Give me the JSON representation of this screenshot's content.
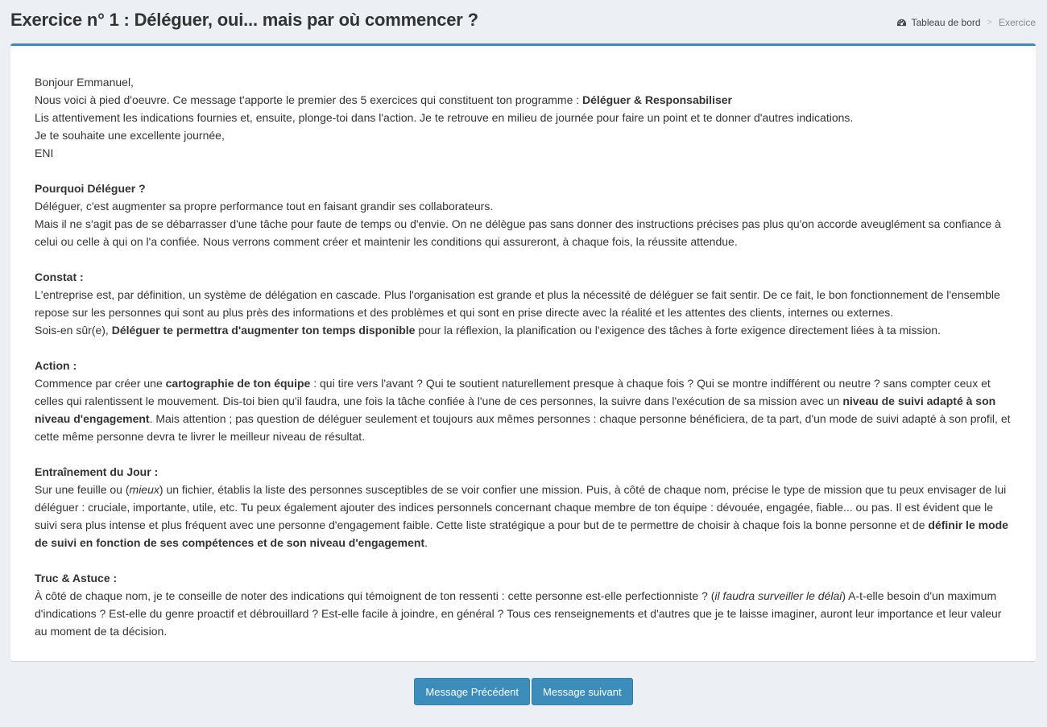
{
  "header": {
    "title": "Exercice n° 1 : Déléguer, oui... mais par où commencer ?",
    "breadcrumb": {
      "home": "Tableau de bord",
      "current": "Exercice"
    }
  },
  "message": {
    "intro": {
      "greeting": "Bonjour Emmanuel,",
      "line2_text": "Nous voici à pied d'oeuvre. Ce message t'apporte le premier des 5 exercices qui constituent ton programme : ",
      "line2_bold": "Déléguer & Responsabiliser",
      "line3": "Lis attentivement les indications fournies et, ensuite, plonge-toi dans l'action. Je te retrouve en milieu de journée pour faire un point et te donner d'autres indications.",
      "line4": "Je te souhaite une excellente journée,",
      "signature": "ENI"
    },
    "pourquoi": {
      "heading": "Pourquoi Déléguer ?",
      "p1": "Déléguer, c'est augmenter sa propre performance tout en faisant grandir ses collaborateurs.",
      "p2": "Mais il ne s'agit pas de se débarrasser d'une tâche pour faute de temps ou d'envie. On ne délègue pas sans donner des instructions précises pas plus qu'on accorde aveuglément sa confiance à celui ou celle à qui on l'a confiée. Nous verrons comment créer et maintenir les conditions qui assureront, à chaque fois, la réussite attendue."
    },
    "constat": {
      "heading": "Constat :",
      "p1": "L'entreprise est, par définition, un système de délégation en cascade. Plus l'organisation est grande et plus la nécessité de déléguer se fait sentir. De ce fait, le bon fonctionnement de l'ensemble repose sur les personnes qui sont au plus près des informations et des problèmes et qui sont en prise directe avec la réalité et les attentes des clients, internes ou externes.",
      "p2_start": "Sois-en sûr(e), ",
      "p2_bold": "Déléguer te permettra d'augmenter ton temps disponible",
      "p2_end": " pour la réflexion, la planification ou l'exigence des tâches à forte exigence directement liées à ta mission."
    },
    "action": {
      "heading": "Action :",
      "t1": "Commence par créer une ",
      "b1": "cartographie de ton équipe",
      "t2": " : qui tire vers l'avant ? Qui te soutient naturellement presque à chaque fois ? Qui se montre indifférent ou neutre ? sans compter ceux et celles qui ralentissent le mouvement. Dis-toi bien qu'il faudra, une fois la tâche confiée à l'une de ces personnes, la suivre dans l'exécution de sa mission avec un ",
      "b2": "niveau de suivi adapté à son niveau d'engagement",
      "t3": ". Mais attention ; pas question de déléguer seulement et toujours aux mêmes personnes : chaque personne bénéficiera, de ta part, d'un mode de suivi adapté à son profil, et cette même personne devra te livrer le meilleur niveau de résultat."
    },
    "entrainement": {
      "heading": "Entraînement du Jour :",
      "t1": "Sur une feuille ou (",
      "i1": "mieux",
      "t2": ") un fichier, établis la liste des personnes susceptibles de se voir confier une mission. Puis, à côté de chaque nom, précise le type de mission que tu peux envisager de lui déléguer : cruciale, importante, utile, etc. Tu peux également ajouter des indices personnels concernant chaque membre de ton équipe : dévouée, engagée, fiable... ou pas. Il est évident que le suivi sera plus intense et plus fréquent avec une personne d'engagement faible. Cette liste stratégique a pour but de te permettre de choisir à chaque fois la bonne personne et de ",
      "b1": "définir le mode de suivi en fonction de ses compétences et de son niveau d'engagement",
      "t3": "."
    },
    "astuce": {
      "heading": "Truc & Astuce :",
      "t1": "À côté de chaque nom, je te conseille de noter des indications qui témoignent de ton ressenti : cette personne est-elle perfectionniste ? (",
      "i1": "il faudra surveiller le délai",
      "t2": ") A-t-elle besoin d'un maximum d'indications ? Est-elle du genre proactif et débrouillard ? Est-elle facile à joindre, en général ? Tous ces renseignements et d'autres que je te laisse imaginer, auront leur importance et leur valeur au moment de ta décision."
    }
  },
  "nav": {
    "prev_label": "Message Précédent",
    "next_label": "Message suivant"
  },
  "colors": {
    "accent": "#3c8dbc",
    "background": "#ecf0f5"
  },
  "icons": {
    "breadcrumb_home": "dashboard-icon"
  }
}
